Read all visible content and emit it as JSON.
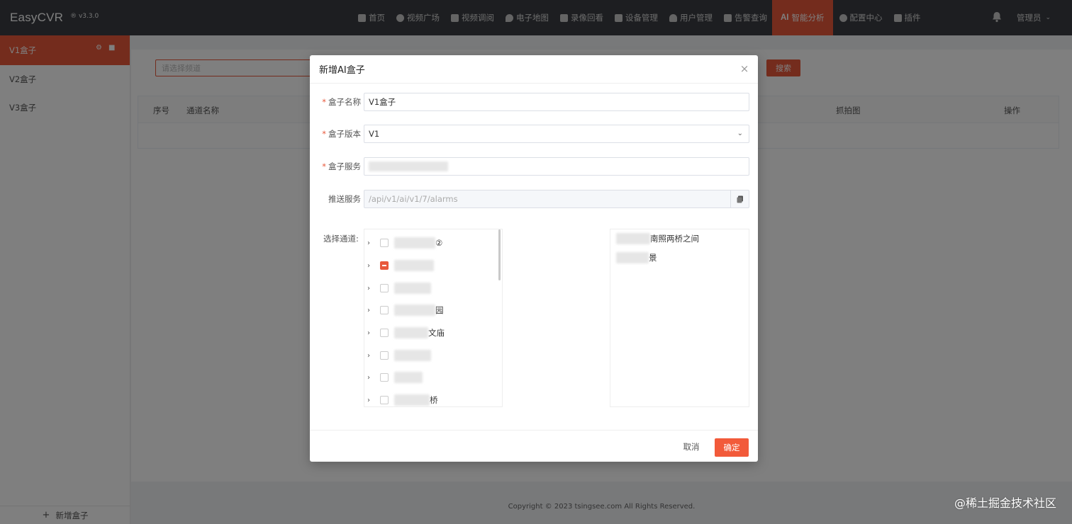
{
  "topbar": {
    "app_name": "EasyCVR",
    "version": "v3.3.0",
    "version_mark": "®",
    "nav": [
      {
        "label": "首页",
        "icon": "home-icon"
      },
      {
        "label": "视频广场",
        "icon": "play-circle-icon"
      },
      {
        "label": "视频调阅",
        "icon": "grid-icon"
      },
      {
        "label": "电子地图",
        "icon": "map-pin-icon"
      },
      {
        "label": "录像回看",
        "icon": "video-camera-icon"
      },
      {
        "label": "设备管理",
        "icon": "device-icon"
      },
      {
        "label": "用户管理",
        "icon": "user-icon"
      },
      {
        "label": "告警查询",
        "icon": "alarm-icon"
      },
      {
        "label": "智能分析",
        "prefix": "AI",
        "icon": "ai-icon",
        "active": true
      },
      {
        "label": "配置中心",
        "icon": "gear-icon"
      },
      {
        "label": "插件",
        "icon": "puzzle-icon"
      }
    ],
    "user": "管理员"
  },
  "sidebar": {
    "items": [
      {
        "label": "V1盒子",
        "active": true
      },
      {
        "label": "V2盒子"
      },
      {
        "label": "V3盒子"
      }
    ],
    "add_label": "新增盒子"
  },
  "main": {
    "search_placeholder": "请选择频道",
    "search_button": "搜索",
    "columns": [
      "序号",
      "通道名称",
      "抓拍图",
      "操作"
    ],
    "copyright": "Copyright © 2023 tsingsee.com All Rights Reserved."
  },
  "modal": {
    "title": "新增AI盒子",
    "fields": {
      "name_label": "盒子名称",
      "name_value": "V1盒子",
      "version_label": "盒子版本",
      "version_value": "V1",
      "service_label": "盒子服务",
      "push_label": "推送服务",
      "push_value": "/api/v1/ai/v1/7/alarms",
      "channel_label": "选择通道:"
    },
    "tree": [
      {
        "suffix": "②",
        "check": "none"
      },
      {
        "suffix": "",
        "check": "indeterminate"
      },
      {
        "suffix": "",
        "check": "none"
      },
      {
        "suffix": "园",
        "check": "none"
      },
      {
        "suffix": "文庙",
        "check": "none"
      },
      {
        "suffix": "",
        "check": "none"
      },
      {
        "suffix": "",
        "check": "none"
      },
      {
        "suffix": "桥",
        "check": "none"
      }
    ],
    "selected": [
      {
        "suffix": "南照两桥之间"
      },
      {
        "suffix": "景"
      }
    ],
    "cancel_label": "取消",
    "ok_label": "确定"
  },
  "credit": "@稀土掘金技术社区",
  "colors": {
    "accent": "#e8583b",
    "topbar": "#3a3d42"
  }
}
